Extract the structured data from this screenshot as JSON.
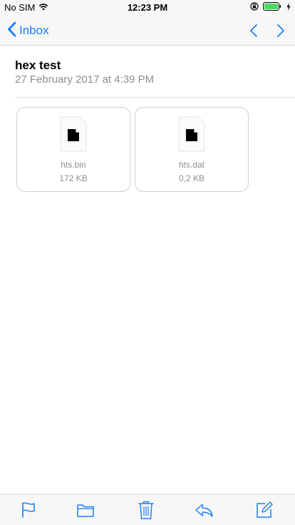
{
  "status_bar": {
    "carrier": "No SIM",
    "time": "12:23 PM",
    "battery_color": "#4cd964"
  },
  "nav": {
    "back_label": "Inbox",
    "accent_color": "#1a7ff5"
  },
  "message": {
    "subject": "hex test",
    "date": "27 February 2017 at 4:39 PM"
  },
  "attachments": [
    {
      "name": "hts.bin",
      "size": "172 KB",
      "icon": "document-icon"
    },
    {
      "name": "hts.dat",
      "size": "0,2 KB",
      "icon": "document-icon"
    }
  ],
  "toolbar": {
    "icons": [
      "flag-icon",
      "folder-icon",
      "trash-icon",
      "reply-icon",
      "compose-icon"
    ]
  }
}
